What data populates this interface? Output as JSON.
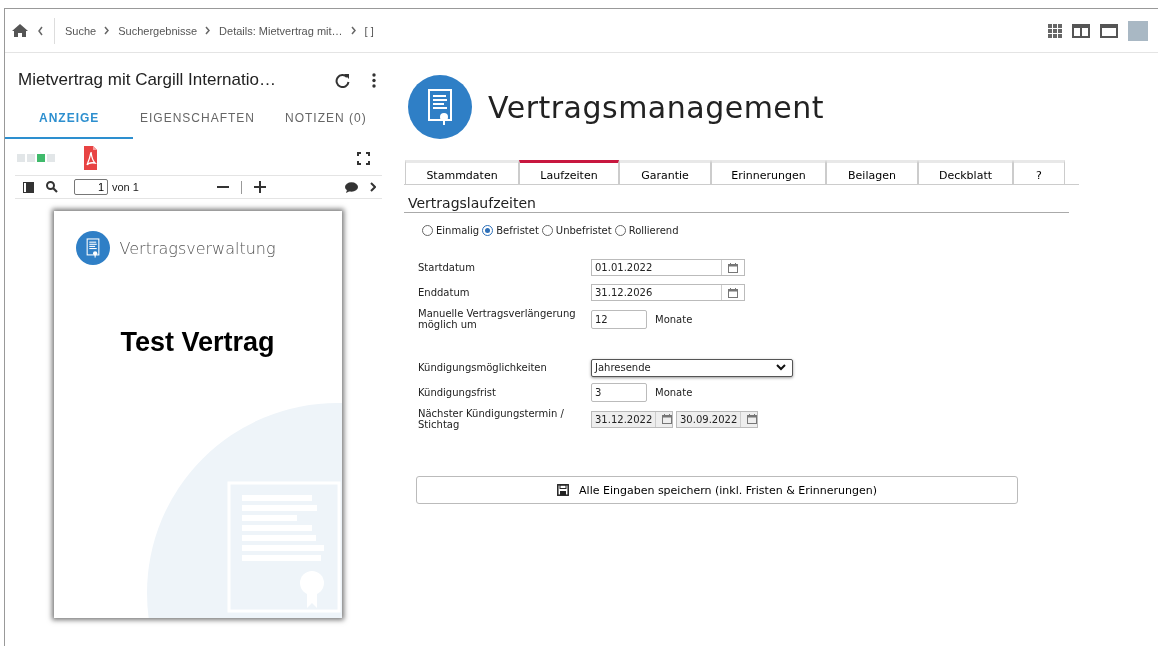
{
  "breadcrumb": [
    "Suche",
    "Suchergebnisse",
    "Details: Mietvertrag mit…",
    "[ ]"
  ],
  "document": {
    "title": "Mietvertrag mit Cargill Internatio…",
    "tabs": [
      {
        "label": "ANZEIGE",
        "selected": true
      },
      {
        "label": "EIGENSCHAFTEN",
        "selected": false
      },
      {
        "label": "NOTIZEN (0)",
        "selected": false
      }
    ],
    "view_indicators": [
      {
        "selected": false
      },
      {
        "selected": false
      },
      {
        "selected": true
      },
      {
        "selected": false
      }
    ],
    "page_input": "1",
    "page_total": "von 1",
    "preview": {
      "brand": "Vertragsverwaltung",
      "heading": "Test Vertrag"
    }
  },
  "app": {
    "title": "Vertragsmanagement",
    "tabs": [
      {
        "label": "Stammdaten",
        "selected": false
      },
      {
        "label": "Laufzeiten",
        "selected": true
      },
      {
        "label": "Garantie",
        "selected": false
      },
      {
        "label": "Erinnerungen",
        "selected": false
      },
      {
        "label": "Beilagen",
        "selected": false
      },
      {
        "label": "Deckblatt",
        "selected": false
      },
      {
        "label": "?",
        "selected": false
      }
    ],
    "section_title": "Vertragslaufzeiten",
    "term_types": [
      {
        "label": "Einmalig",
        "selected": false
      },
      {
        "label": "Befristet",
        "selected": true
      },
      {
        "label": "Unbefristet",
        "selected": false
      },
      {
        "label": "Rollierend",
        "selected": false
      }
    ],
    "fields": [
      {
        "kind": "date",
        "label": "Startdatum",
        "value": "01.01.2022",
        "disabled": false
      },
      {
        "kind": "date",
        "label": "Enddatum",
        "value": "31.12.2026",
        "disabled": false
      },
      {
        "kind": "number",
        "label": "Manuelle Vertragsverlängerung möglich um",
        "value": "12",
        "unit": "Monate",
        "disabled": false
      },
      {
        "kind": "select",
        "label": "Kündigungsmöglichkeiten",
        "value": "Jahresende",
        "disabled": false
      },
      {
        "kind": "number",
        "label": "Kündigungsfrist",
        "value": "3",
        "unit": "Monate",
        "disabled": false
      },
      {
        "kind": "datepair",
        "label": "Nächster Kündigungstermin / Stichtag",
        "values": [
          "31.12.2022",
          "30.09.2022"
        ],
        "disabled": true
      }
    ],
    "save_button": "Alle Eingaben speichern (inkl. Fristen & Erinnerungen)"
  }
}
